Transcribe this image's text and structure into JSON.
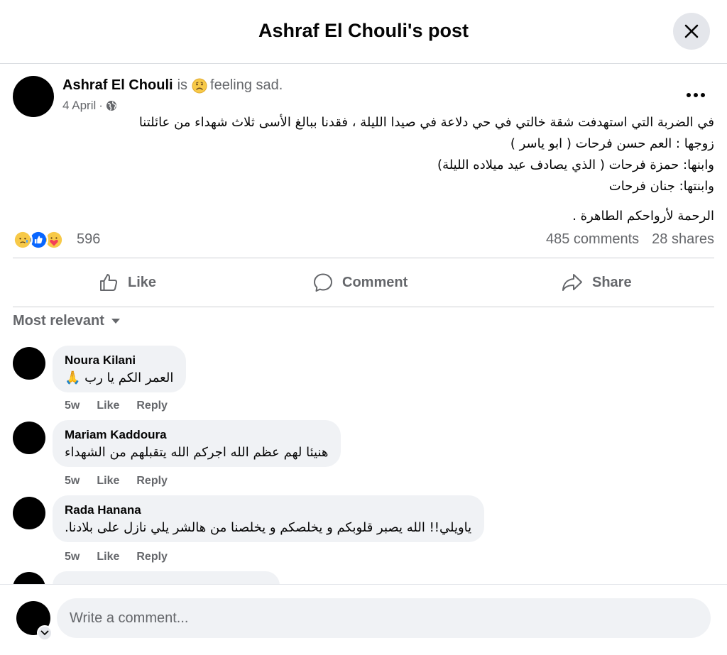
{
  "header": {
    "title": "Ashraf El Chouli's post"
  },
  "post": {
    "author": "Ashraf El Chouli",
    "is_word": "is",
    "feeling": "feeling sad.",
    "date": "4 April",
    "dot": "·",
    "lines": [
      "في الضربة التي استهدفت شقة خالتي في حي دلاعة في صيدا الليلة ، فقدنا ببالغ الأسى ثلاث شهداء من عائلتنا",
      "زوجها : العم حسن فرحات ( ابو ياسر )",
      "وابنها: حمزة فرحات ( الذي يصادف عيد ميلاده الليلة)",
      "وابنتها: جنان فرحات"
    ],
    "closing": "الرحمة لأرواحكم الطاهرة ."
  },
  "stats": {
    "reactions_count": "596",
    "comments": "485 comments",
    "shares": "28 shares"
  },
  "actions": {
    "like": "Like",
    "comment": "Comment",
    "share": "Share"
  },
  "sort": {
    "label": "Most relevant"
  },
  "comments": [
    {
      "name": "Noura Kilani",
      "text": "العمر الكم يا رب 🙏",
      "time": "5w",
      "like": "Like",
      "reply": "Reply"
    },
    {
      "name": "Mariam Kaddoura",
      "text": "هنيئا لهم عظم الله اجركم الله يتقبلهم من الشهداء",
      "time": "5w",
      "like": "Like",
      "reply": "Reply"
    },
    {
      "name": "Rada Hanana",
      "text": "ياويلي!! الله يصبر قلوبكم و يخلصكم و يخلصنا من هالشر يلي نازل على بلادنا.",
      "time": "5w",
      "like": "Like",
      "reply": "Reply"
    }
  ],
  "composer": {
    "placeholder": "Write a comment..."
  },
  "colors": {
    "accent": "#0866ff",
    "secondary_text": "#65676b",
    "bubble": "#f0f2f5",
    "divider": "#ced0d4"
  },
  "icons": {
    "close": "close-icon",
    "more": "more-horizontal-icon",
    "globe": "globe-icon",
    "feeling": "sad-face-emoji",
    "reactions": [
      "care-reaction-icon",
      "like-reaction-icon",
      "love-hug-reaction-icon"
    ],
    "like": "thumbs-up-icon",
    "comment": "comment-bubble-icon",
    "share": "share-arrow-icon",
    "sort": "caret-down-icon",
    "composer": "chevron-down-icon"
  }
}
